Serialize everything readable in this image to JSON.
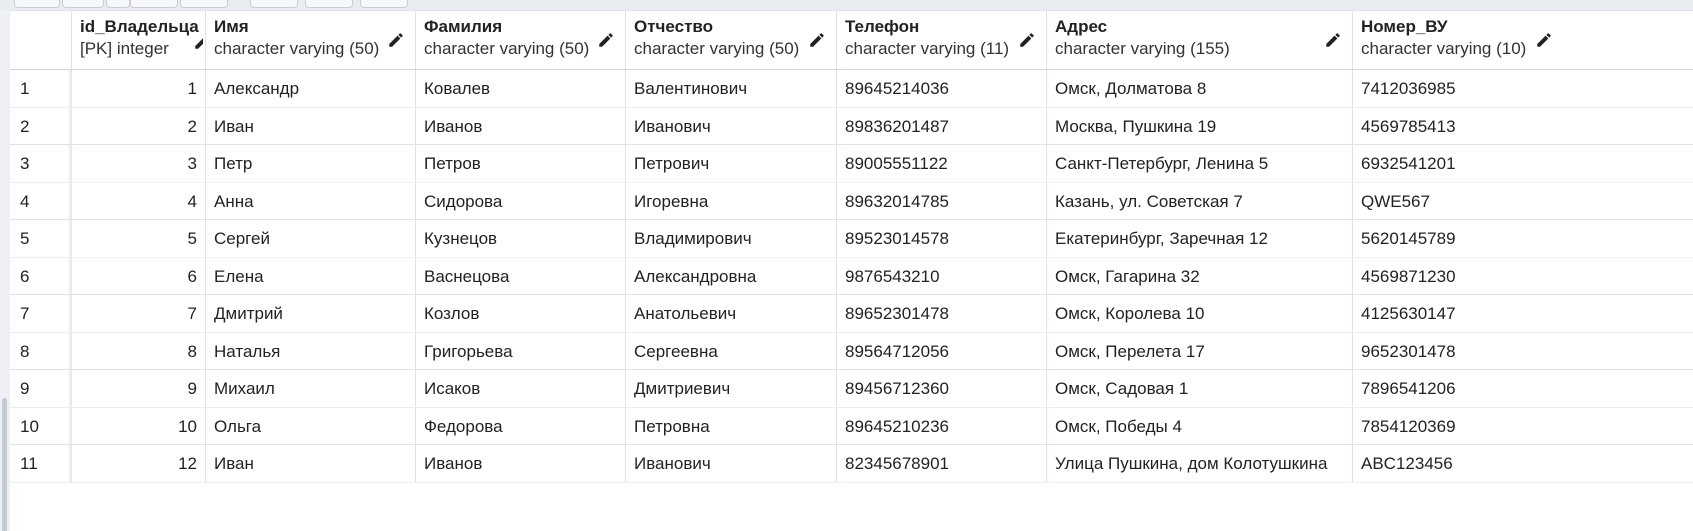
{
  "columns": [
    {
      "name": "",
      "type": ""
    },
    {
      "name": "id_Владельца",
      "type": "[PK] integer"
    },
    {
      "name": "Имя",
      "type": "character varying (50)"
    },
    {
      "name": "Фамилия",
      "type": "character varying (50)"
    },
    {
      "name": "Отчество",
      "type": "character varying (50)"
    },
    {
      "name": "Телефон",
      "type": "character varying (11)"
    },
    {
      "name": "Адрес",
      "type": "character varying (155)"
    },
    {
      "name": "Номер_ВУ",
      "type": "character varying (10)"
    }
  ],
  "rows": [
    [
      "1",
      "1",
      "Александр",
      "Ковалев",
      "Валентинович",
      "89645214036",
      "Омск, Долматова 8",
      "7412036985"
    ],
    [
      "2",
      "2",
      "Иван",
      "Иванов",
      "Иванович",
      "89836201487",
      "Москва, Пушкина 19",
      "4569785413"
    ],
    [
      "3",
      "3",
      "Петр",
      "Петров",
      "Петрович",
      "89005551122",
      "Санкт-Петербург, Ленина 5",
      "6932541201"
    ],
    [
      "4",
      "4",
      "Анна",
      "Сидорова",
      "Игоревна",
      "89632014785",
      "Казань, ул. Советская 7",
      "QWE567"
    ],
    [
      "5",
      "5",
      "Сергей",
      "Кузнецов",
      "Владимирович",
      "89523014578",
      "Екатеринбург, Заречная 12",
      "5620145789"
    ],
    [
      "6",
      "6",
      "Елена",
      "Васнецова",
      "Александровна",
      "9876543210",
      "Омск, Гагарина 32",
      "4569871230"
    ],
    [
      "7",
      "7",
      "Дмитрий",
      "Козлов",
      "Анатольевич",
      "89652301478",
      "Омск, Королева 10",
      "4125630147"
    ],
    [
      "8",
      "8",
      "Наталья",
      "Григорьева",
      "Сергеевна",
      "89564712056",
      "Омск, Перелета 17",
      "9652301478"
    ],
    [
      "9",
      "9",
      "Михаил",
      "Исаков",
      "Дмитриевич",
      "89456712360",
      "Омск, Садовая 1",
      "7896541206"
    ],
    [
      "10",
      "10",
      "Ольга",
      "Федорова",
      "Петровна",
      "89645210236",
      "Омск, Победы 4",
      "7854120369"
    ],
    [
      "11",
      "12",
      "Иван",
      "Иванов",
      "Иванович",
      "82345678901",
      "Улица Пушкина, дом Колотушкина",
      "ABC123456"
    ]
  ],
  "icons": {
    "edit": "pencil-icon"
  },
  "colors": {
    "border": "#dfe2e6",
    "header_bg": "#ffffff",
    "toolbar_bg": "#e9ecf1"
  }
}
